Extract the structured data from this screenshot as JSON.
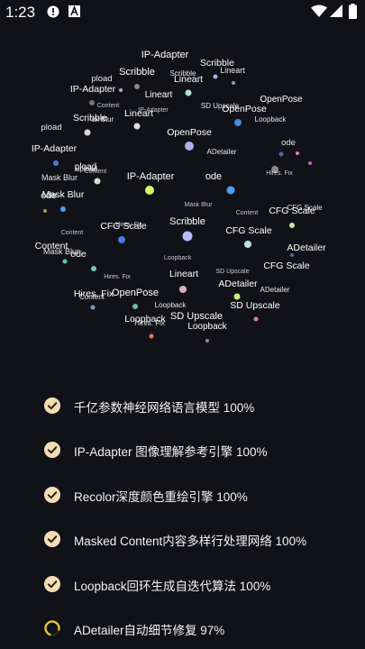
{
  "status_bar": {
    "time": "1:23",
    "left_icons": [
      "alert-circle-icon",
      "font-a-icon"
    ],
    "right_icons": [
      "wifi-icon",
      "cellular-signal-icon",
      "battery-icon"
    ]
  },
  "tag_cloud": {
    "labels": [
      {
        "text": "IP-Adapter",
        "size": 11,
        "fill": "#ffffff"
      },
      {
        "text": "Scribble",
        "size": 10.5,
        "fill": "#ffffff"
      },
      {
        "text": "Lineart",
        "size": 9,
        "fill": "#ffffff"
      },
      {
        "text": "pload",
        "size": 9.5,
        "fill": "#ffffff"
      },
      {
        "text": "Scribble",
        "size": 11,
        "fill": "#ffffff"
      },
      {
        "text": "Scribble",
        "size": 8,
        "fill": "#ffffff"
      },
      {
        "text": "Lineart",
        "size": 10.5,
        "fill": "#ffffff"
      },
      {
        "text": "IP-Adapter",
        "size": 10.5,
        "fill": "#ffffff"
      },
      {
        "text": "Lineart",
        "size": 10,
        "fill": "#ffffff"
      },
      {
        "text": "Content",
        "size": 7,
        "fill": "#ffffff"
      },
      {
        "text": "SD Upscale",
        "size": 8,
        "fill": "#ffffff"
      },
      {
        "text": "Scribble",
        "size": 10.5,
        "fill": "#ffffff"
      },
      {
        "text": "sk Blur",
        "size": 8,
        "fill": "#ffffff"
      },
      {
        "text": "Lineart",
        "size": 10.5,
        "fill": "#ffffff"
      },
      {
        "text": "IP-Adapter",
        "size": 7,
        "fill": "#ffffff"
      },
      {
        "text": "OpenPose",
        "size": 10.5,
        "fill": "#ffffff"
      },
      {
        "text": "OpenPose",
        "size": 10,
        "fill": "#ffffff"
      },
      {
        "text": "Loopback",
        "size": 8,
        "fill": "#ffffff"
      },
      {
        "text": "pload",
        "size": 9.5,
        "fill": "#ffffff"
      },
      {
        "text": "OpenPose",
        "size": 10.5,
        "fill": "#ffffff"
      },
      {
        "text": "ode",
        "size": 9.5,
        "fill": "#ffffff"
      },
      {
        "text": "IP-Adapter",
        "size": 10.5,
        "fill": "#ffffff"
      },
      {
        "text": "ADetailer",
        "size": 8,
        "fill": "#ffffff"
      },
      {
        "text": "pload",
        "size": 10,
        "fill": "#ffffff"
      },
      {
        "text": "upload",
        "size": 8,
        "fill": "#ffffff"
      },
      {
        "text": "Content",
        "size": 7,
        "fill": "#ffffff"
      },
      {
        "text": "Hires. Fix",
        "size": 7,
        "fill": "#ffffff"
      },
      {
        "text": "Mask Blur",
        "size": 9,
        "fill": "#ffffff"
      },
      {
        "text": "IP-Adapter",
        "size": 11,
        "fill": "#ffffff"
      },
      {
        "text": "ode",
        "size": 11,
        "fill": "#ffffff"
      },
      {
        "text": "ode",
        "size": 10.5,
        "fill": "#ffffff"
      },
      {
        "text": "Mask Blur",
        "size": 10.5,
        "fill": "#ffffff"
      },
      {
        "text": "Mask Blur",
        "size": 7,
        "fill": "#ffffff"
      },
      {
        "text": "CFG Scale",
        "size": 8,
        "fill": "#ffffff"
      },
      {
        "text": "CFG Scale",
        "size": 10.5,
        "fill": "#ffffff"
      },
      {
        "text": "CFG Scale",
        "size": 10.5,
        "fill": "#ffffff"
      },
      {
        "text": "Scribble",
        "size": 11,
        "fill": "#ffffff"
      },
      {
        "text": "Hires. Fix",
        "size": 7,
        "fill": "#ffffff"
      },
      {
        "text": "Content",
        "size": 7,
        "fill": "#ffffff"
      },
      {
        "text": "CFG Scale",
        "size": 10.5,
        "fill": "#ffffff"
      },
      {
        "text": "Content",
        "size": 7,
        "fill": "#ffffff"
      },
      {
        "text": "Content",
        "size": 10.5,
        "fill": "#ffffff"
      },
      {
        "text": "Mask Blur",
        "size": 9,
        "fill": "#ffffff"
      },
      {
        "text": "ode",
        "size": 10.5,
        "fill": "#ffffff"
      },
      {
        "text": "ADetailer",
        "size": 10.5,
        "fill": "#ffffff"
      },
      {
        "text": "CFG Scale",
        "size": 10.5,
        "fill": "#ffffff"
      },
      {
        "text": "Loopback",
        "size": 7,
        "fill": "#ffffff"
      },
      {
        "text": "SD Upscale",
        "size": 7,
        "fill": "#ffffff"
      },
      {
        "text": "Hires. Fix",
        "size": 7,
        "fill": "#ffffff"
      },
      {
        "text": "Lineart",
        "size": 10.5,
        "fill": "#ffffff"
      },
      {
        "text": "ADetailer",
        "size": 10.5,
        "fill": "#ffffff"
      },
      {
        "text": "ADetailer",
        "size": 8,
        "fill": "#ffffff"
      },
      {
        "text": "Hires. Fix",
        "size": 10.5,
        "fill": "#ffffff"
      },
      {
        "text": "Content",
        "size": 8,
        "fill": "#ffffff"
      },
      {
        "text": "OpenPose",
        "size": 11,
        "fill": "#ffffff"
      },
      {
        "text": "Loopback",
        "size": 8,
        "fill": "#ffffff"
      },
      {
        "text": "SD Upscale",
        "size": 11,
        "fill": "#ffffff"
      },
      {
        "text": "SD Upscale",
        "size": 10.5,
        "fill": "#ffffff"
      },
      {
        "text": "Loopback",
        "size": 10.5,
        "fill": "#ffffff"
      },
      {
        "text": "Hires. Fix",
        "size": 8,
        "fill": "#ffffff"
      },
      {
        "text": "Loopback",
        "size": 10,
        "fill": "#ffffff"
      }
    ],
    "dots": [
      {
        "color": "#888888"
      },
      {
        "color": "#a3b5e0"
      },
      {
        "color": "#9a9a9a"
      },
      {
        "color": "#c4a8c8"
      },
      {
        "color": "#b3e0d0"
      },
      {
        "color": "#3d8ee0"
      },
      {
        "color": "#777777"
      },
      {
        "color": "#e0d8d0"
      },
      {
        "color": "#e0e0e0"
      },
      {
        "color": "#aeb0e8"
      },
      {
        "color": "#d8f56a"
      },
      {
        "color": "#d0e0d0"
      },
      {
        "color": "#4aa0f0"
      },
      {
        "color": "#4a7adc"
      },
      {
        "color": "#4aa0f0"
      },
      {
        "color": "#b8b8ff"
      },
      {
        "color": "#c0e0e0"
      },
      {
        "color": "#d0e8a0"
      },
      {
        "color": "#e0b0c0"
      },
      {
        "color": "#c8f080"
      },
      {
        "color": "#e080a0"
      },
      {
        "color": "#80c0c0"
      },
      {
        "color": "#60c8a0"
      },
      {
        "color": "#c060c0"
      },
      {
        "color": "#e080c0"
      },
      {
        "color": "#6060a0"
      },
      {
        "color": "#888888"
      },
      {
        "color": "#a0a040"
      },
      {
        "color": "#6060a0"
      },
      {
        "color": "#4a7adc"
      },
      {
        "color": "#70a0c0"
      },
      {
        "color": "#e08060"
      },
      {
        "color": "#a080c0"
      },
      {
        "color": "#70c0a0"
      }
    ]
  },
  "tasks": [
    {
      "label": "千亿参数神经网络语言模型 100%",
      "state": "done"
    },
    {
      "label": "IP-Adapter 图像理解参考引擎 100%",
      "state": "done"
    },
    {
      "label": "Recolor深度颜色重绘引擎 100%",
      "state": "done"
    },
    {
      "label": "Masked Content内容多样行处理网络 100%",
      "state": "done"
    },
    {
      "label": "Loopback回环生成自迭代算法 100%",
      "state": "done"
    },
    {
      "label": "ADetailer自动细节修复 97%",
      "state": "loading",
      "progress": 0.97
    }
  ],
  "colors": {
    "background": "#111218",
    "check_fill": "#f4dcb4",
    "check_mark": "#2a2210",
    "spinner": "#e2c43a"
  }
}
